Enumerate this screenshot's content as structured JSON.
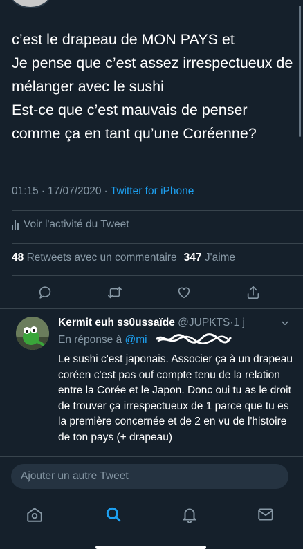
{
  "tweet": {
    "text": "c’est le drapeau de MON PAYS et\nJe pense que c’est assez irrespectueux de mélanger avec le sushi\nEst-ce que c’est mauvais de penser comme ça en tant qu’une Coréenne?",
    "time": "01:15",
    "date": "17/07/2020",
    "separator": "·",
    "source": "Twitter for iPhone",
    "activity_label": "Voir l'activité du Tweet",
    "retweets_count": "48",
    "retweets_label": "Retweets avec un commentaire",
    "likes_count": "347",
    "likes_label": "J'aime"
  },
  "actions": [
    "reply-icon",
    "retweet-icon",
    "like-icon",
    "share-icon"
  ],
  "reply": {
    "display_name": "Kermit euh ss0ussaïde",
    "handle": "@JUPKTS",
    "time_sep": "·",
    "time": "1 j",
    "replying_to_label": "En réponse à",
    "replying_to_mention": "@mi",
    "text": "Le sushi c'est japonais. Associer ça à un drapeau coréen c'est pas ouf compte tenu de la relation entre la Corée et le Japon. Donc oui tu as le droit de trouver ça irrespectueux de 1 parce que tu es la première concernée et de 2 en vu de l'histoire de ton pays (+ drapeau)"
  },
  "compose": {
    "placeholder": "Ajouter un autre Tweet"
  },
  "tabbar": {
    "items": [
      "home-icon",
      "search-icon",
      "notifications-icon",
      "messages-icon"
    ],
    "active": "search-icon"
  },
  "colors": {
    "background": "#15202b",
    "accent": "#1da1f2",
    "secondary_text": "#8899a6",
    "divider": "#38444d"
  }
}
